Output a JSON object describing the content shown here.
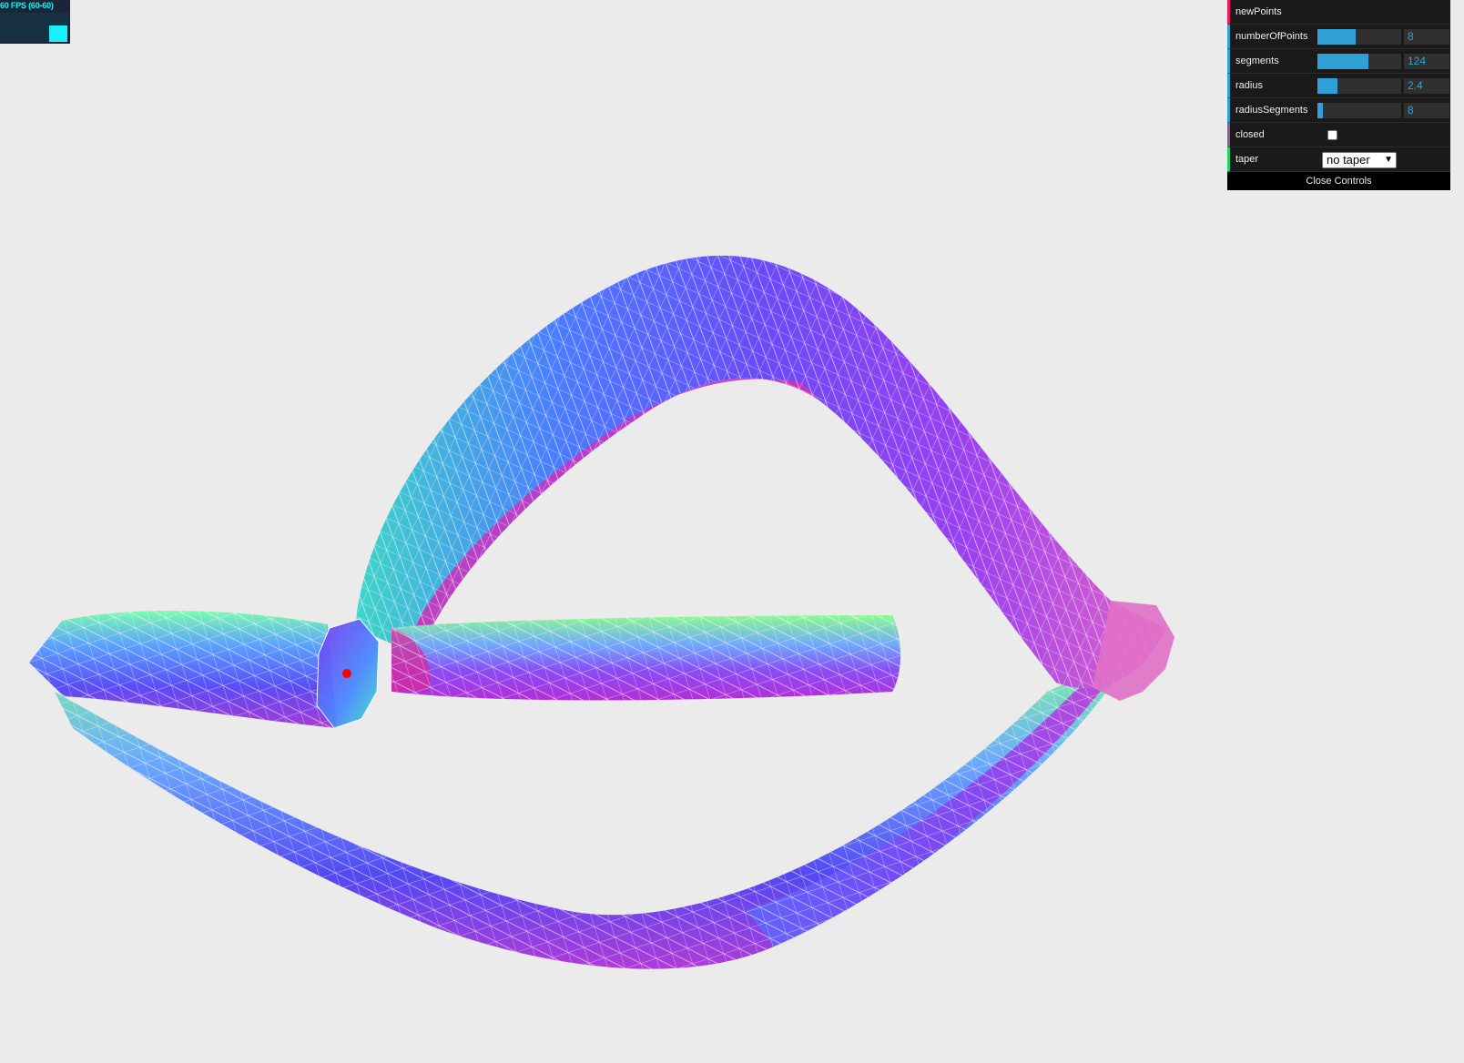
{
  "stats": {
    "fps_text": "60 FPS (60-60)"
  },
  "gui": {
    "controllers": [
      {
        "type": "function",
        "label": "newPoints"
      },
      {
        "type": "number",
        "label": "numberOfPoints",
        "value": "8",
        "fill": 0.46
      },
      {
        "type": "number",
        "label": "segments",
        "value": "124",
        "fill": 0.61
      },
      {
        "type": "number",
        "label": "radius",
        "value": "2.4",
        "fill": 0.24
      },
      {
        "type": "number",
        "label": "radiusSegments",
        "value": "8",
        "fill": 0.07
      },
      {
        "type": "boolean",
        "label": "closed",
        "checked": false
      },
      {
        "type": "select",
        "label": "taper",
        "value": "no taper"
      }
    ],
    "close_label": "Close Controls"
  },
  "scene": {
    "description_colors": {
      "cyan": "#40e8c8",
      "blue": "#5a5cff",
      "violet": "#8a3cf0",
      "magenta": "#d22fd8",
      "green": "#7dfc8a"
    },
    "marker_color": "#ff0000"
  }
}
